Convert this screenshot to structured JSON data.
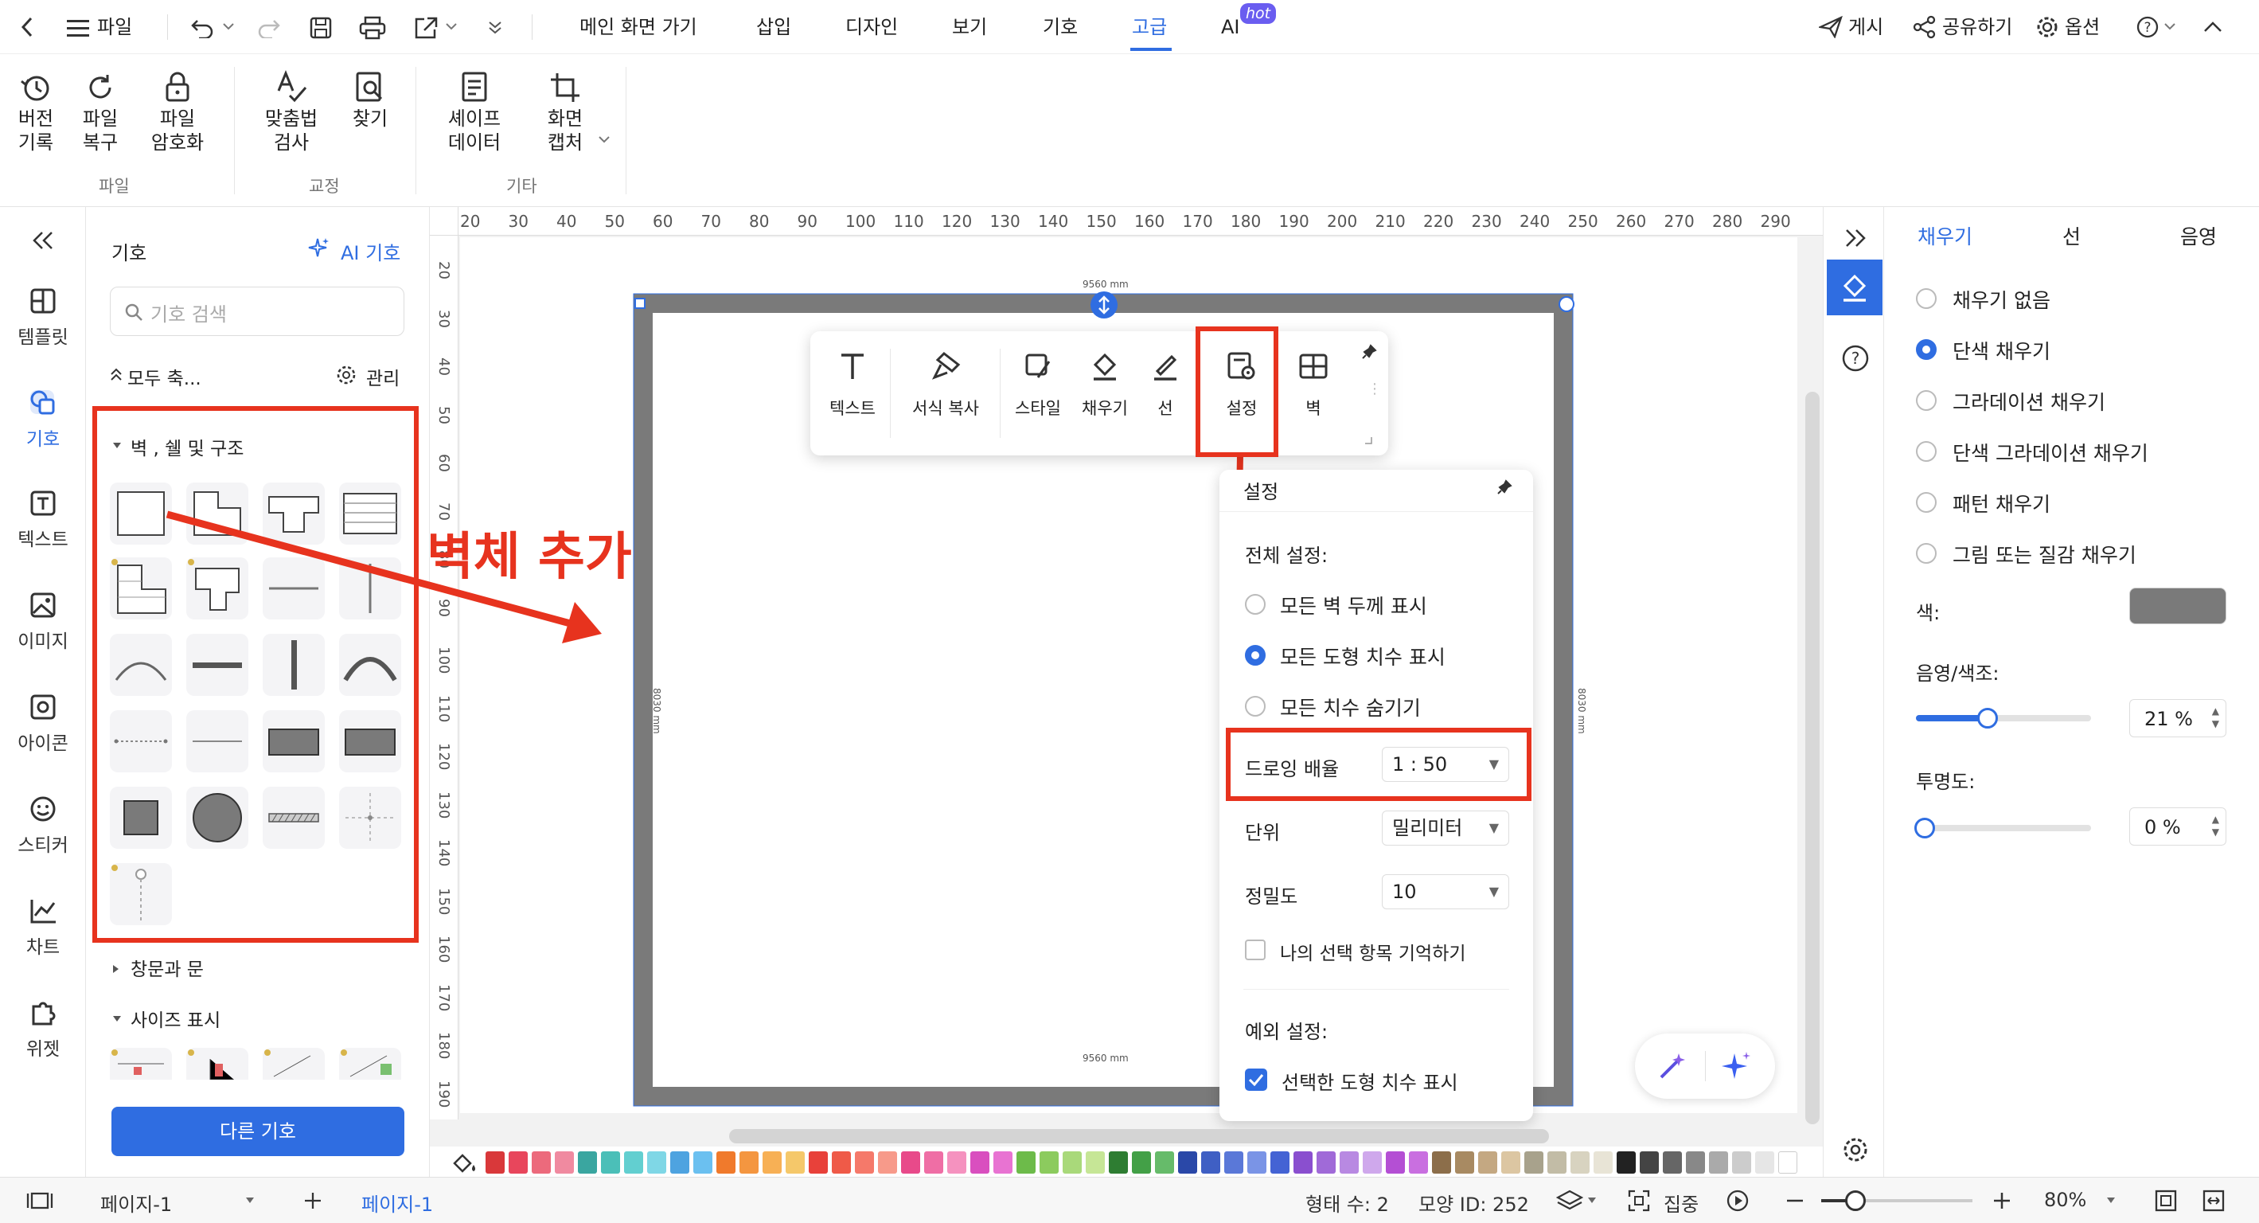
{
  "topbar": {
    "file": "파일",
    "tabs": [
      "메인 화면 가기",
      "삽입",
      "디자인",
      "보기",
      "기호",
      "고급",
      "AI"
    ],
    "active_tab": "고급",
    "hot_badge": "hot",
    "publish": "게시",
    "share": "공유하기",
    "options": "옵션"
  },
  "ribbon": {
    "version_history": [
      "버전",
      "기록"
    ],
    "file_recover": [
      "파일",
      "복구"
    ],
    "file_encrypt": [
      "파일",
      "암호화"
    ],
    "spell_check": [
      "맞춤법",
      "검사"
    ],
    "find": "찾기",
    "shape_data": [
      "셰이프",
      "데이터"
    ],
    "screen_capture": [
      "화면",
      "캡처"
    ],
    "groups": [
      "파일",
      "교정",
      "기타"
    ]
  },
  "leftnav": {
    "items": [
      "템플릿",
      "기호",
      "텍스트",
      "이미지",
      "아이콘",
      "스티커",
      "차트",
      "위젯"
    ],
    "active": "기호"
  },
  "library": {
    "title": "기호",
    "ai_symbol": "AI 기호",
    "search_placeholder": "기호 검색",
    "collapse_all": "모두 축...",
    "manage": "관리",
    "section_walls": "벽 , 쉘 및 구조",
    "section_windows": "창문과 문",
    "section_dimension": "사이즈 표시",
    "more_symbols": "다른 기호"
  },
  "ruler": {
    "top": [
      "20",
      "30",
      "40",
      "50",
      "60",
      "70",
      "80",
      "90",
      "100",
      "110",
      "120",
      "130",
      "140",
      "150",
      "160",
      "170",
      "180",
      "190",
      "200",
      "210",
      "220",
      "230",
      "240",
      "250",
      "260",
      "270",
      "280",
      "290"
    ],
    "left": [
      "20",
      "30",
      "40",
      "50",
      "60",
      "70",
      "80",
      "90",
      "100",
      "110",
      "120",
      "130",
      "140",
      "150",
      "160",
      "170",
      "180",
      "190"
    ]
  },
  "canvas": {
    "dim_top": "9560 mm",
    "dim_bottom": "9560 mm",
    "dim_left": "8030 mm",
    "dim_right": "8030 mm",
    "annotation": "벽체 추가"
  },
  "floatbar": {
    "items": [
      "텍스트",
      "서식 복사",
      "스타일",
      "채우기",
      "선",
      "설정",
      "벽"
    ]
  },
  "settings": {
    "title": "설정",
    "global_label": "전체 설정:",
    "opt1": "모든 벽 두께 표시",
    "opt2": "모든 도형 치수 표시",
    "opt3": "모든 치수 숨기기",
    "scale_label": "드로잉 배율",
    "scale_value": "1 : 50",
    "unit_label": "단위",
    "unit_value": "밀리미터",
    "precision_label": "정밀도",
    "precision_value": "10",
    "remember": "나의 선택 항목 기억하기",
    "exception_label": "예외 설정:",
    "exception_opt": "선택한 도형 치수 표시"
  },
  "rightpanel": {
    "tabs": [
      "채우기",
      "선",
      "음영"
    ],
    "fill_options": [
      "채우기 없음",
      "단색 채우기",
      "그라데이션 채우기",
      "단색 그라데이션 채우기",
      "패턴 채우기",
      "그림 또는 질감 채우기"
    ],
    "selected_fill": "단색 채우기",
    "color_label": "색:",
    "color_value": "#7a7a7a",
    "shade_label": "음영/색조:",
    "shade_value": "21 %",
    "shade_fraction": 0.21,
    "transparency_label": "투명도:",
    "transparency_value": "0 %",
    "transparency_fraction": 0
  },
  "status": {
    "page_select": "페이지-1",
    "page_tab": "페이지-1",
    "shape_count": "형태 수: 2",
    "shape_id": "모양 ID: 252",
    "focus": "집중",
    "zoom": "80%"
  },
  "palette": [
    "#d9383a",
    "#e8465c",
    "#ec6a7c",
    "#f08aa0",
    "#3aa6a0",
    "#4bbfb8",
    "#62cfd0",
    "#7fd7e6",
    "#4ea3e0",
    "#6bc0f0",
    "#f07a2c",
    "#f49640",
    "#f7b055",
    "#f5c86a",
    "#e8413a",
    "#ef5a48",
    "#f5796a",
    "#f79a8a",
    "#e84a8a",
    "#ef6ea5",
    "#f592bf",
    "#d94fbf",
    "#e873d2",
    "#6dbb4a",
    "#8ccb5e",
    "#a9d97a",
    "#c6e696",
    "#2e7d32",
    "#43a047",
    "#66bb6a",
    "#2a48a8",
    "#3f5fc4",
    "#5a78d8",
    "#7a94e6",
    "#4463d4",
    "#8a4fcf",
    "#a06ad8",
    "#b889e2",
    "#cfa8ec",
    "#b44fd4",
    "#c96fe0",
    "#8c6e4a",
    "#a88a62",
    "#c4a882",
    "#dcc6a2",
    "#a8a28c",
    "#c2bca6",
    "#d8d3c0",
    "#e8e4d6",
    "#222222",
    "#444444",
    "#666666",
    "#888888",
    "#aaaaaa",
    "#cccccc",
    "#e6e6e6",
    "#ffffff"
  ]
}
